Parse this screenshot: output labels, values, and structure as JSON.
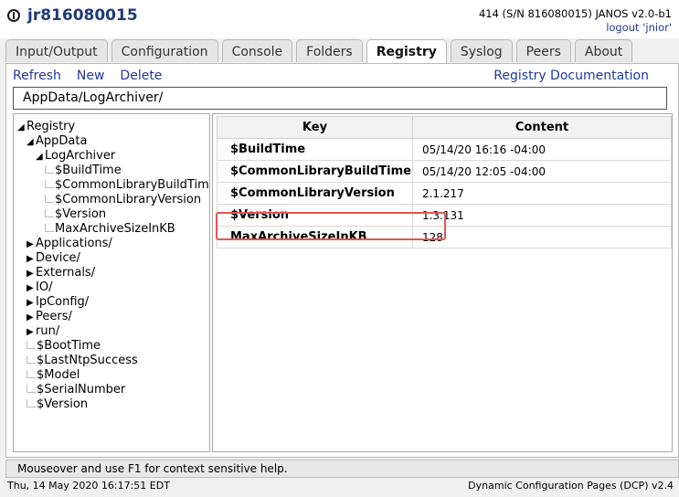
{
  "header": {
    "title": "jr816080015",
    "serial_line": "414 (S/N 816080015) JANOS v2.0-b1",
    "logout": "logout 'jnior'"
  },
  "tabs": [
    "Input/Output",
    "Configuration",
    "Console",
    "Folders",
    "Registry",
    "Syslog",
    "Peers",
    "About"
  ],
  "active_tab": "Registry",
  "actions": {
    "refresh": "Refresh",
    "new": "New",
    "delete": "Delete",
    "docs": "Registry Documentation"
  },
  "path": "AppData/LogArchiver/",
  "tree": [
    {
      "label": "Registry",
      "glyph": "◢"
    },
    {
      "label": "AppData",
      "glyph": "◢"
    },
    {
      "label": "LogArchiver",
      "glyph": "◢"
    },
    {
      "label": "$BuildTime",
      "glyph": ""
    },
    {
      "label": "$CommonLibraryBuildTime",
      "glyph": ""
    },
    {
      "label": "$CommonLibraryVersion",
      "glyph": ""
    },
    {
      "label": "$Version",
      "glyph": ""
    },
    {
      "label": "MaxArchiveSizeInKB",
      "glyph": ""
    },
    {
      "label": "Applications/",
      "glyph": "▶"
    },
    {
      "label": "Device/",
      "glyph": "▶"
    },
    {
      "label": "Externals/",
      "glyph": "▶"
    },
    {
      "label": "IO/",
      "glyph": "▶"
    },
    {
      "label": "IpConfig/",
      "glyph": "▶"
    },
    {
      "label": "Peers/",
      "glyph": "▶"
    },
    {
      "label": "run/",
      "glyph": "▶"
    },
    {
      "label": "$BootTime",
      "glyph": ""
    },
    {
      "label": "$LastNtpSuccess",
      "glyph": ""
    },
    {
      "label": "$Model",
      "glyph": ""
    },
    {
      "label": "$SerialNumber",
      "glyph": ""
    },
    {
      "label": "$Version",
      "glyph": ""
    }
  ],
  "table": {
    "headers": {
      "key": "Key",
      "content": "Content"
    },
    "rows": [
      {
        "key": "$BuildTime",
        "content": "05/14/20 16:16 -04:00"
      },
      {
        "key": "$CommonLibraryBuildTime",
        "content": "05/14/20 12:05 -04:00"
      },
      {
        "key": "$CommonLibraryVersion",
        "content": "2.1.217"
      },
      {
        "key": "$Version",
        "content": "1.3.131"
      },
      {
        "key": "MaxArchiveSizeInKB",
        "content": "128"
      }
    ]
  },
  "help_text": "Mouseover and use F1 for context sensitive help.",
  "footer": {
    "datetime": "Thu, 14 May 2020 16:17:51 EDT",
    "version": "Dynamic Configuration Pages (DCP) v2.4"
  },
  "colors": {
    "link": "#1f3a9a",
    "title": "#1f3a7a",
    "highlight": "#e25555"
  }
}
